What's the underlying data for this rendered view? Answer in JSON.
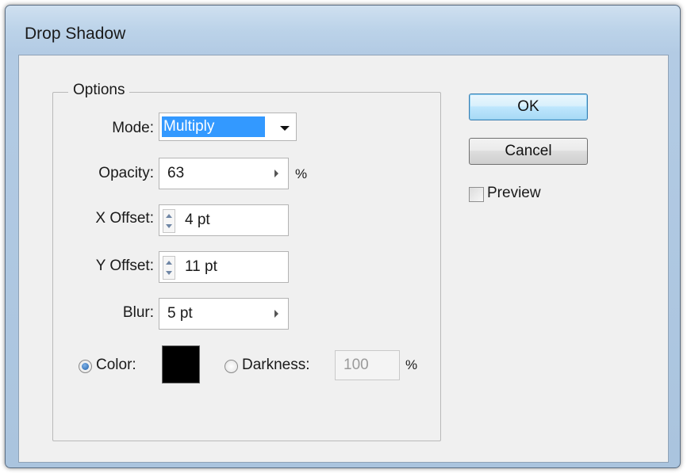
{
  "window": {
    "title": "Drop Shadow"
  },
  "options": {
    "group_label": "Options",
    "mode": {
      "label": "Mode:",
      "value": "Multiply"
    },
    "opacity": {
      "label": "Opacity:",
      "value": "63",
      "unit": "%"
    },
    "x_offset": {
      "label": "X Offset:",
      "value": "4 pt"
    },
    "y_offset": {
      "label": "Y Offset:",
      "value": "11 pt"
    },
    "blur": {
      "label": "Blur:",
      "value": "5 pt"
    },
    "color": {
      "label": "Color:",
      "selected": true,
      "swatch": "#000000"
    },
    "darkness": {
      "label": "Darkness:",
      "value": "100",
      "unit": "%",
      "selected": false
    }
  },
  "buttons": {
    "ok": "OK",
    "cancel": "Cancel"
  },
  "preview": {
    "label": "Preview",
    "checked": false
  }
}
